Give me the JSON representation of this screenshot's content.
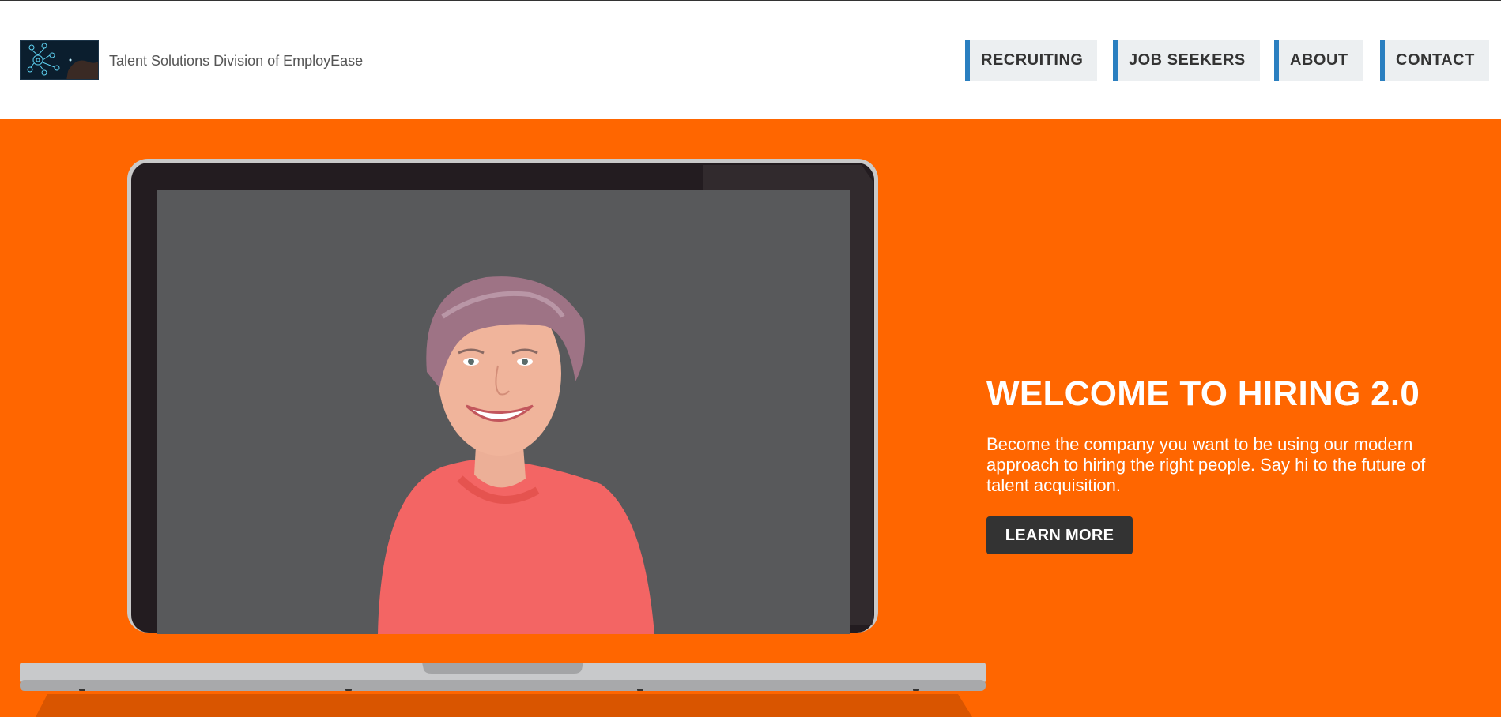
{
  "header": {
    "logo_icon": "gear-network-icon",
    "brand_text": "Talent Solutions Division of EmployEase",
    "nav": [
      {
        "label": "RECRUITING"
      },
      {
        "label": "JOB SEEKERS"
      },
      {
        "label": "ABOUT"
      },
      {
        "label": "CONTACT"
      }
    ],
    "nav_accent": "#2a7fc0",
    "nav_bg": "#eceff1"
  },
  "hero": {
    "background": "#ff6600",
    "headline": "WELCOME TO HIRING 2.0",
    "body": "Become the company you want to be using our modern approach to hiring the right people. Say hi to the future of talent acquisition.",
    "cta_label": "LEARN MORE",
    "cta_color": "#333333"
  }
}
